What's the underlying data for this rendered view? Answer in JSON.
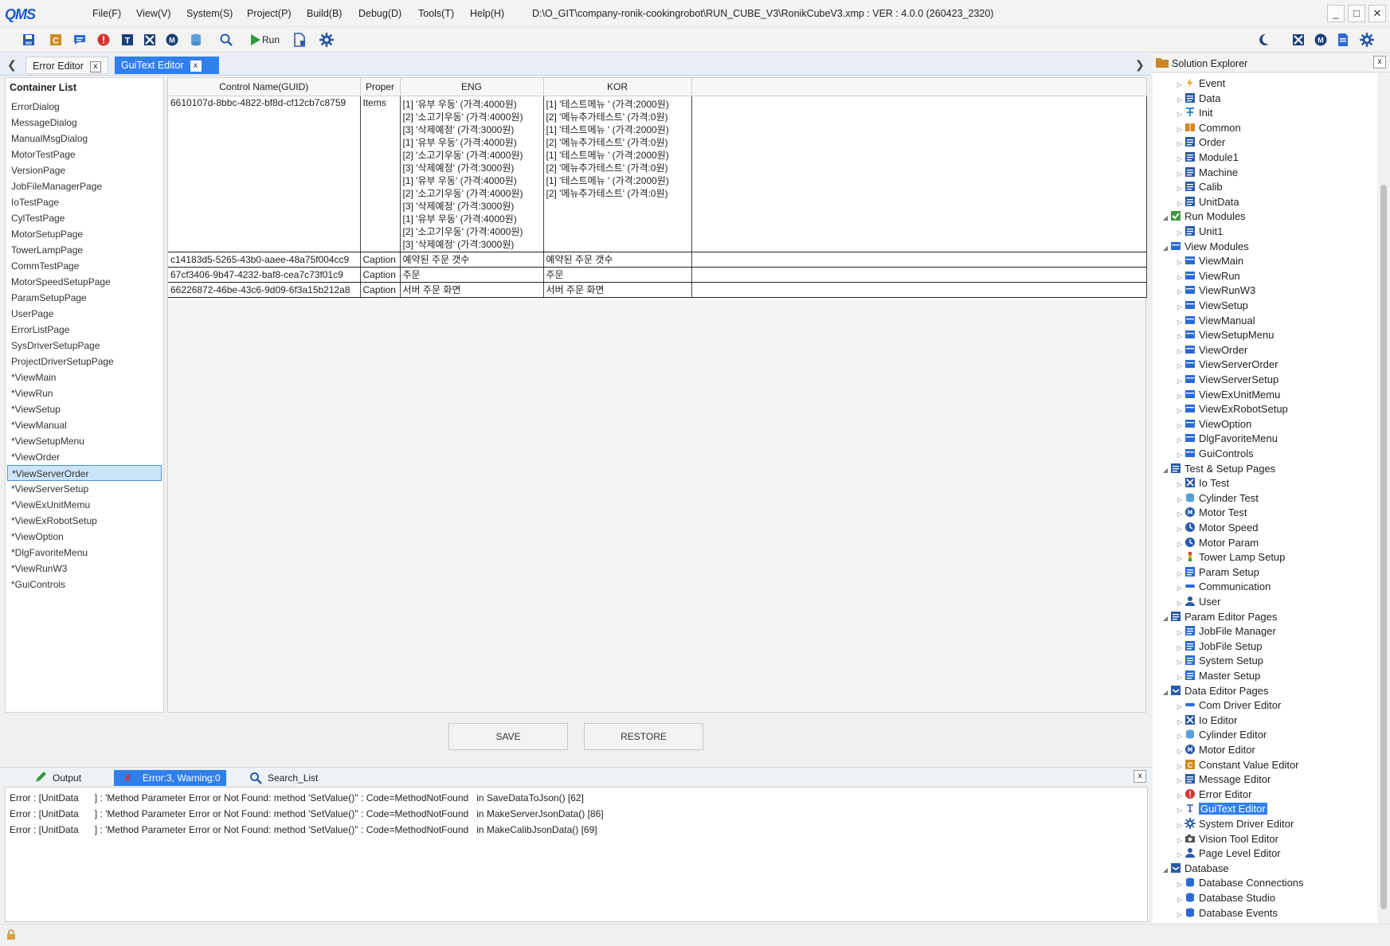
{
  "app": {
    "logo": "QMS",
    "title": "D:\\O_GIT\\company-ronik-cookingrobot\\RUN_CUBE_V3\\RonikCubeV3.xmp :  VER : 4.0.0 (260423_2320)"
  },
  "menu": [
    "File(F)",
    "View(V)",
    "System(S)",
    "Project(P)",
    "Build(B)",
    "Debug(D)",
    "Tools(T)",
    "Help(H)"
  ],
  "toolbar": {
    "run_label": "Run"
  },
  "tabs": [
    {
      "label": "Error Editor",
      "close": "x"
    },
    {
      "label": "GuiText Editor",
      "close": "x"
    }
  ],
  "container_list": {
    "title": "Container List",
    "selected_index": 23,
    "items": [
      "ErrorDialog",
      "MessageDialog",
      "ManualMsgDialog",
      "MotorTestPage",
      "VersionPage",
      "JobFileManagerPage",
      "IoTestPage",
      "CylTestPage",
      "MotorSetupPage",
      "TowerLampPage",
      "CommTestPage",
      "MotorSpeedSetupPage",
      "ParamSetupPage",
      "UserPage",
      "ErrorListPage",
      "SysDriverSetupPage",
      "ProjectDriverSetupPage",
      "*ViewMain",
      "*ViewRun",
      "*ViewSetup",
      "*ViewManual",
      "*ViewSetupMenu",
      "*ViewOrder",
      "*ViewServerOrder",
      "*ViewServerSetup",
      "*ViewExUnitMemu",
      "*ViewExRobotSetup",
      "*ViewOption",
      "*DlgFavoriteMenu",
      "*ViewRunW3",
      "*GuiControls"
    ]
  },
  "grid": {
    "columns": [
      "Control Name(GUID)",
      "Proper",
      "ENG",
      "KOR"
    ],
    "rows": [
      {
        "guid": "6610107d-8bbc-4822-bf8d-cf12cb7c8759",
        "prop": "Items",
        "eng": [
          "[1] '유부 우동' (가격:4000원)",
          "[2] '소고기우동' (가격:4000원)",
          "[3] '삭제예정' (가격:3000원)",
          "[1] '유부 우동' (가격:4000원)",
          "[2] '소고기우동' (가격:4000원)",
          "[3] '삭제예정' (가격:3000원)",
          "[1] '유부 우동' (가격:4000원)",
          "[2] '소고기우동' (가격:4000원)",
          "[3] '삭제예정' (가격:3000원)",
          "[1] '유부 우동' (가격:4000원)",
          "[2] '소고기우동' (가격:4000원)",
          "[3] '삭제예정' (가격:3000원)"
        ],
        "kor": [
          "[1] '테스트메뉴 ' (가격:2000원)",
          "[2] '메뉴추가테스트' (가격:0원)",
          "[1] '테스트메뉴 ' (가격:2000원)",
          "[2] '메뉴추가테스트' (가격:0원)",
          "[1] '테스트메뉴 ' (가격:2000원)",
          "[2] '메뉴추가테스트' (가격:0원)",
          "[1] '테스트메뉴 ' (가격:2000원)",
          "[2] '메뉴추가테스트' (가격:0원)"
        ]
      },
      {
        "guid": "c14183d5-5265-43b0-aaee-48a75f004cc9",
        "prop": "Caption",
        "eng": "예약된 주문 갯수",
        "kor": "예약된 주문 갯수"
      },
      {
        "guid": "67cf3406-9b47-4232-baf8-cea7c73f01c9",
        "prop": "Caption",
        "eng": "주문",
        "kor": "주문"
      },
      {
        "guid": "66226872-46be-43c6-9d09-6f3a15b212a8",
        "prop": "Caption",
        "eng": "서버 주문 화면",
        "kor": "서버 주문 화면"
      }
    ]
  },
  "buttons": {
    "save": "SAVE",
    "restore": "RESTORE"
  },
  "output": {
    "tabs": [
      "Output",
      "Error:3, Warning:0",
      "Search_List"
    ],
    "close": "x",
    "lines": [
      "Error : [UnitData      ] : 'Method Parameter Error or Not Found: method 'SetValue()'' : Code=MethodNotFound   in SaveDataToJson() [62]",
      "Error : [UnitData      ] : 'Method Parameter Error or Not Found: method 'SetValue()'' : Code=MethodNotFound   in MakeServerJsonData() [86]",
      "Error : [UnitData      ] : 'Method Parameter Error or Not Found: method 'SetValue()'' : Code=MethodNotFound   in MakeCalibJsonData() [69]"
    ]
  },
  "solution_explorer": {
    "title": "Solution Explorer",
    "close": "x",
    "nodes": [
      {
        "label": "Event",
        "level": 1,
        "icon": "lightning-icon",
        "color": "#f0a030"
      },
      {
        "label": "Data",
        "level": 1,
        "icon": "list-icon",
        "color": "#2a5aa8"
      },
      {
        "label": "Init",
        "level": 1,
        "icon": "init-icon",
        "color": "#2a8ad8"
      },
      {
        "label": "Common",
        "level": 1,
        "icon": "book-icon",
        "color": "#d08a20"
      },
      {
        "label": "Order",
        "level": 1,
        "icon": "list-icon",
        "color": "#2a5aa8"
      },
      {
        "label": "Module1",
        "level": 1,
        "icon": "list-icon",
        "color": "#2a5aa8"
      },
      {
        "label": "Machine",
        "level": 1,
        "icon": "list-icon",
        "color": "#2a5aa8"
      },
      {
        "label": "Calib",
        "level": 1,
        "icon": "list-icon",
        "color": "#2a5aa8"
      },
      {
        "label": "UnitData",
        "level": 1,
        "icon": "list-icon",
        "color": "#2a5aa8"
      },
      {
        "label": "Run Modules",
        "level": 0,
        "icon": "check-icon",
        "color": "#3a9a3a"
      },
      {
        "label": "Unit1",
        "level": 1,
        "icon": "list-icon",
        "color": "#2a5aa8"
      },
      {
        "label": "View Modules",
        "level": 0,
        "icon": "window-icon",
        "color": "#2a6ad8"
      },
      {
        "label": "ViewMain",
        "level": 1,
        "icon": "window-icon",
        "color": "#2a6ad8"
      },
      {
        "label": "ViewRun",
        "level": 1,
        "icon": "window-icon",
        "color": "#2a6ad8"
      },
      {
        "label": "ViewRunW3",
        "level": 1,
        "icon": "window-icon",
        "color": "#2a6ad8"
      },
      {
        "label": "ViewSetup",
        "level": 1,
        "icon": "window-icon",
        "color": "#2a6ad8"
      },
      {
        "label": "ViewManual",
        "level": 1,
        "icon": "window-icon",
        "color": "#2a6ad8"
      },
      {
        "label": "ViewSetupMenu",
        "level": 1,
        "icon": "window-icon",
        "color": "#2a6ad8"
      },
      {
        "label": "ViewOrder",
        "level": 1,
        "icon": "window-icon",
        "color": "#2a6ad8"
      },
      {
        "label": "ViewServerOrder",
        "level": 1,
        "icon": "window-icon",
        "color": "#2a6ad8"
      },
      {
        "label": "ViewServerSetup",
        "level": 1,
        "icon": "window-icon",
        "color": "#2a6ad8"
      },
      {
        "label": "ViewExUnitMemu",
        "level": 1,
        "icon": "window-icon",
        "color": "#2a6ad8"
      },
      {
        "label": "ViewExRobotSetup",
        "level": 1,
        "icon": "window-icon",
        "color": "#2a6ad8"
      },
      {
        "label": "ViewOption",
        "level": 1,
        "icon": "window-icon",
        "color": "#2a6ad8"
      },
      {
        "label": "DlgFavoriteMenu",
        "level": 1,
        "icon": "window-icon",
        "color": "#2a6ad8"
      },
      {
        "label": "GuiControls",
        "level": 1,
        "icon": "window-icon",
        "color": "#2a6ad8"
      },
      {
        "label": "Test & Setup Pages",
        "level": 0,
        "icon": "list-icon",
        "color": "#2a5aa8"
      },
      {
        "label": "Io Test",
        "level": 1,
        "icon": "io-icon",
        "color": "#2a5aa8"
      },
      {
        "label": "Cylinder Test",
        "level": 1,
        "icon": "cylinder-icon",
        "color": "#5aa0d8"
      },
      {
        "label": "Motor Test",
        "level": 1,
        "icon": "motor-icon",
        "color": "#2a5aa8"
      },
      {
        "label": "Motor Speed",
        "level": 1,
        "icon": "speed-icon",
        "color": "#2a5aa8"
      },
      {
        "label": "Motor Param",
        "level": 1,
        "icon": "clock-icon",
        "color": "#2a5aa8"
      },
      {
        "label": "Tower Lamp Setup",
        "level": 1,
        "icon": "lamp-icon",
        "color": "#d84040"
      },
      {
        "label": "Param Setup",
        "level": 1,
        "icon": "doc-icon",
        "color": "#2a6ad8"
      },
      {
        "label": "Communication",
        "level": 1,
        "icon": "cable-icon",
        "color": "#2a6ad8"
      },
      {
        "label": "User",
        "level": 1,
        "icon": "user-icon",
        "color": "#2a5aa8"
      },
      {
        "label": "Param Editor Pages",
        "level": 0,
        "icon": "list-icon",
        "color": "#2a5aa8"
      },
      {
        "label": "JobFile Manager",
        "level": 1,
        "icon": "doc-icon",
        "color": "#2a6ad8"
      },
      {
        "label": "JobFile Setup",
        "level": 1,
        "icon": "doc-icon",
        "color": "#2a6ad8"
      },
      {
        "label": "System Setup",
        "level": 1,
        "icon": "doc-icon",
        "color": "#2a6ad8"
      },
      {
        "label": "Master Setup",
        "level": 1,
        "icon": "doc-icon",
        "color": "#2a6ad8"
      },
      {
        "label": "Data Editor Pages",
        "level": 0,
        "icon": "checkbox-icon",
        "color": "#2a5aa8"
      },
      {
        "label": "Com Driver Editor",
        "level": 1,
        "icon": "cable-icon",
        "color": "#2a6ad8"
      },
      {
        "label": "Io Editor",
        "level": 1,
        "icon": "io-icon",
        "color": "#2a5aa8"
      },
      {
        "label": "Cylinder Editor",
        "level": 1,
        "icon": "cylinder-icon",
        "color": "#5aa0d8"
      },
      {
        "label": "Motor Editor",
        "level": 1,
        "icon": "motor-icon",
        "color": "#2a5aa8"
      },
      {
        "label": "Constant Value Editor",
        "level": 1,
        "icon": "constant-icon",
        "color": "#d08a20"
      },
      {
        "label": "Message Editor",
        "level": 1,
        "icon": "message-icon",
        "color": "#2a5aa8"
      },
      {
        "label": "Error Editor",
        "level": 1,
        "icon": "error-icon",
        "color": "#d83030"
      },
      {
        "label": "GuiText Editor",
        "level": 1,
        "icon": "text-icon",
        "color": "#2a5aa8",
        "selected": true
      },
      {
        "label": "System Driver Editor",
        "level": 1,
        "icon": "gear-icon",
        "color": "#2a5aa8"
      },
      {
        "label": "Vision Tool Editor",
        "level": 1,
        "icon": "camera-icon",
        "color": "#555555"
      },
      {
        "label": "Page Level Editor",
        "level": 1,
        "icon": "user-icon",
        "color": "#2a5aa8"
      },
      {
        "label": "Database",
        "level": 0,
        "icon": "checkbox-icon",
        "color": "#2a5aa8"
      },
      {
        "label": "Database Connections",
        "level": 1,
        "icon": "cube-icon",
        "color": "#2a6ad8"
      },
      {
        "label": "Database Studio",
        "level": 1,
        "icon": "cube-icon",
        "color": "#2a6ad8"
      },
      {
        "label": "Database Events",
        "level": 1,
        "icon": "cube-icon",
        "color": "#2a6ad8"
      }
    ]
  },
  "colors": {
    "accent": "#2f80ed",
    "selection_bg": "#cce4f7",
    "error": "#d83030"
  }
}
